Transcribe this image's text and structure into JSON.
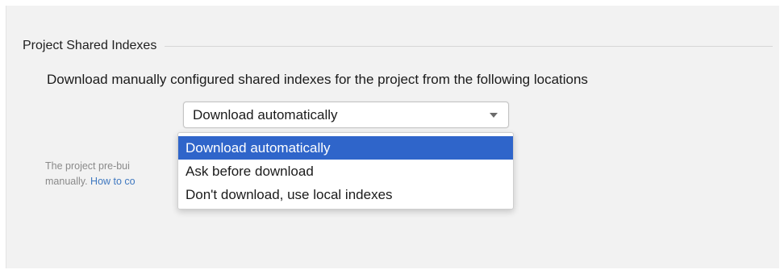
{
  "group": {
    "title": "Project Shared Indexes"
  },
  "description": "Download manually configured shared indexes for the project from the following locations",
  "combo": {
    "selected_value": "Download automatically",
    "icon": "chevron-down-icon"
  },
  "hint": {
    "line1": "The project pre-bui",
    "line2_text": "manually. ",
    "line2_link": "How to co"
  },
  "dropdown": {
    "options": [
      "Download automatically",
      "Ask before download",
      "Don't download, use local indexes"
    ],
    "selected_index": 0
  },
  "colors": {
    "selection": "#2f65ca",
    "link": "#3f78c0",
    "panel_background": "#f2f2f2"
  }
}
